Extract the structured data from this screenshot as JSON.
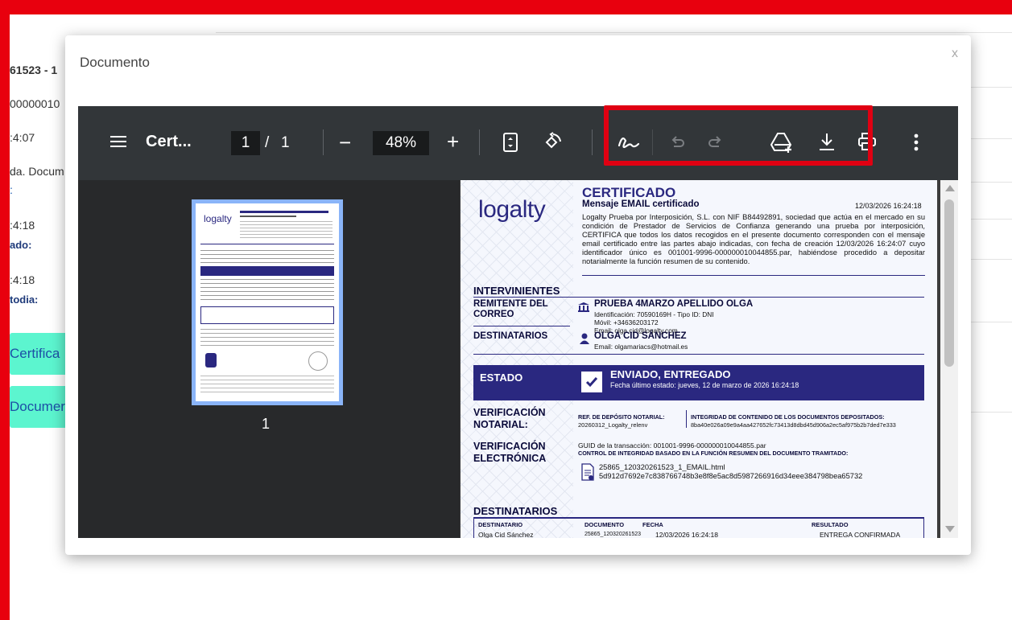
{
  "background": {
    "lines": [
      "61523 - 1",
      "00000010",
      ":4:07",
      "da. Docum",
      ":",
      ":4:18",
      "ado:",
      ":4:18",
      "todia:"
    ],
    "btn_cert": "Certifica",
    "btn_doc": "Documer"
  },
  "modal": {
    "title": "Documento",
    "close": "x"
  },
  "toolbar": {
    "menu_icon": "menu-icon",
    "doc_title": "Cert...",
    "page_current": "1",
    "page_sep": "/",
    "page_total": "1",
    "zoom_out": "−",
    "zoom": "48%",
    "zoom_in": "+",
    "fit_icon": "fit-page-icon",
    "rotate_icon": "rotate-icon",
    "annotate_icon": "annotate-icon",
    "undo_icon": "undo-icon",
    "redo_icon": "redo-icon",
    "drive_icon": "save-to-drive-icon",
    "download_icon": "download-icon",
    "print_icon": "print-icon",
    "more_icon": "more-vert-icon"
  },
  "thumbnail": {
    "page_number": "1"
  },
  "certificate": {
    "logo": "logalty",
    "heading": "CERTIFICADO",
    "subheading": "Mensaje EMAIL certificado",
    "date": "12/03/2026 16:24:18",
    "paragraph": "Logalty Prueba por Interposición, S.L. con NIF B84492891, sociedad que actúa en el mercado en su condición de Prestador de Servicios de Confianza generando una prueba por interposición, CERTIFICA que todos los datos recogidos en el presente documento corresponden con el mensaje email certificado entre las partes abajo indicadas, con fecha de creación 12/03/2026 16:24:07 cuyo identificador único es 001001-9996-000000010044855.par, habiéndose procedido a depositar notarialmente la función resumen de su contenido.",
    "intervinientes": "INTERVINIENTES",
    "remitente_label": "REMITENTE DEL CORREO",
    "remitente_name": "PRUEBA 4MARZO APELLIDO OLGA",
    "remitente_id": "Identificación: 70590169H - Tipo ID: DNI",
    "remitente_movil": "Móvil: +34636203172",
    "remitente_email": "Email: olga.cid@logalty.com",
    "destinatarios_label": "DESTINATARIOS",
    "dest_name": "OLGA CID SÁNCHEZ",
    "dest_email": "Email: olgamariacs@hotmail.es",
    "estado_label": "ESTADO",
    "estado_value": "ENVIADO, ENTREGADO",
    "estado_fecha": "Fecha último estado: jueves, 12 de marzo de 2026 16:24:18",
    "verif_notarial_label": "VERIFICACIÓN NOTARIAL:",
    "ref_deposito_label": "REF. DE DEPÓSITO NOTARIAL:",
    "ref_deposito_value": "20260312_Logalty_relenv",
    "integridad_label": "INTEGRIDAD DE CONTENIDO DE LOS DOCUMENTOS DEPOSITADOS:",
    "integridad_value": "8ba40e026a09e9a4aa427652fc73413d8dbd45d906a2ec5af975b2b7ded7e333",
    "verif_electronica_label": "VERIFICACIÓN ELECTRÓNICA",
    "guid": "GUID de la transacción: 001001-9996-000000010044855.par",
    "control_label": "CONTROL DE INTEGRIDAD BASADO EN LA FUNCIÓN RESUMEN DEL DOCUMENTO TRAMITADO:",
    "file_name": "25865_120320261523_1_EMAIL.html",
    "file_hash": "5d912d7692e7c838766748b3e8f8e5ac8d5987266916d34eee384798bea65732",
    "destinatarios2": "DESTINATARIOS",
    "col_destinatario": "DESTINATARIO",
    "col_documento": "DOCUMENTO",
    "col_fecha": "FECHA",
    "col_resultado": "RESULTADO",
    "row_name": "Olga Cid Sánchez",
    "row_doc": "25865_120320261523",
    "row_fecha": "12/03/2026 16:24:18",
    "row_result": "ENTREGA CONFIRMADA"
  },
  "colors": {
    "annotation": "#e8000e",
    "accent_button": "#5cf5cf",
    "cert_blue": "#2a2880"
  }
}
